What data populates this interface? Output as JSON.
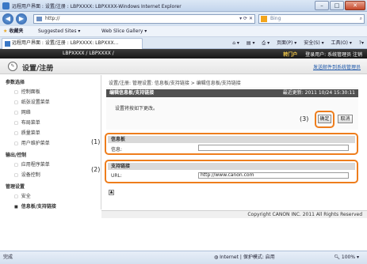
{
  "window": {
    "title": "远程用户界面 : 设置/注册 : LBPXXXX: LBPXXXX-Windows Internet Explorer"
  },
  "browser": {
    "address": "http://",
    "search_placeholder": "Bing",
    "favorites_label": "收藏夹",
    "fav_items": [
      "Suggested Sites ▾",
      "Web Slice Gallery ▾"
    ],
    "tab_title": "远程用户界面 : 设置/注册 : LBPXXXX: LBPXXX...",
    "commands": [
      "页面(P) ▾",
      "安全(S) ▾",
      "工具(O) ▾"
    ],
    "back_glyph": "◀",
    "forward_glyph": "▶"
  },
  "header": {
    "device": "LBPXXXX / LBPXXXX /",
    "portal": "转门户",
    "login_user": "登录用户: 系统管理员 注销",
    "page_title": "设置/注册",
    "mail_link": "发送邮件到系统管理员"
  },
  "sidebar": {
    "sections": [
      {
        "label": "参数选择",
        "items": [
          "控制面板",
          "纸张设置菜单",
          "网络",
          "布局菜单",
          "质量菜单",
          "用户维护菜单"
        ]
      },
      {
        "label": "输出/控制",
        "items": [
          "应用程序菜单",
          "设备控制"
        ]
      },
      {
        "label": "管理设置",
        "items": [
          "安全",
          "信息板/支持链接"
        ]
      }
    ],
    "active": "信息板/支持链接"
  },
  "main": {
    "breadcrumb": "设置/注册: 管理设置: 信息板/支持链接 > 编辑信息板/支持链接",
    "panel_title": "编辑信息板/支持链接",
    "updated": "最近更新: 2011 10/24 15:30:11",
    "hint": "设置将按如下更改。",
    "ok_label": "确定",
    "cancel_label": "取消",
    "callouts": [
      "(1)",
      "(2)",
      "(3)"
    ],
    "info_board": {
      "heading": "信息板",
      "label": "信息:",
      "value": ""
    },
    "support_link": {
      "heading": "支持链接",
      "label": "URL:",
      "value": "http://www.canon.com"
    },
    "back_glyph": "▲"
  },
  "footer": {
    "copyright": "Copyright CANON INC. 2011 All Rights Reserved"
  },
  "status": {
    "left": "完成",
    "zone": "Internet | 保护模式: 启用",
    "zoom": "100% ▾"
  }
}
